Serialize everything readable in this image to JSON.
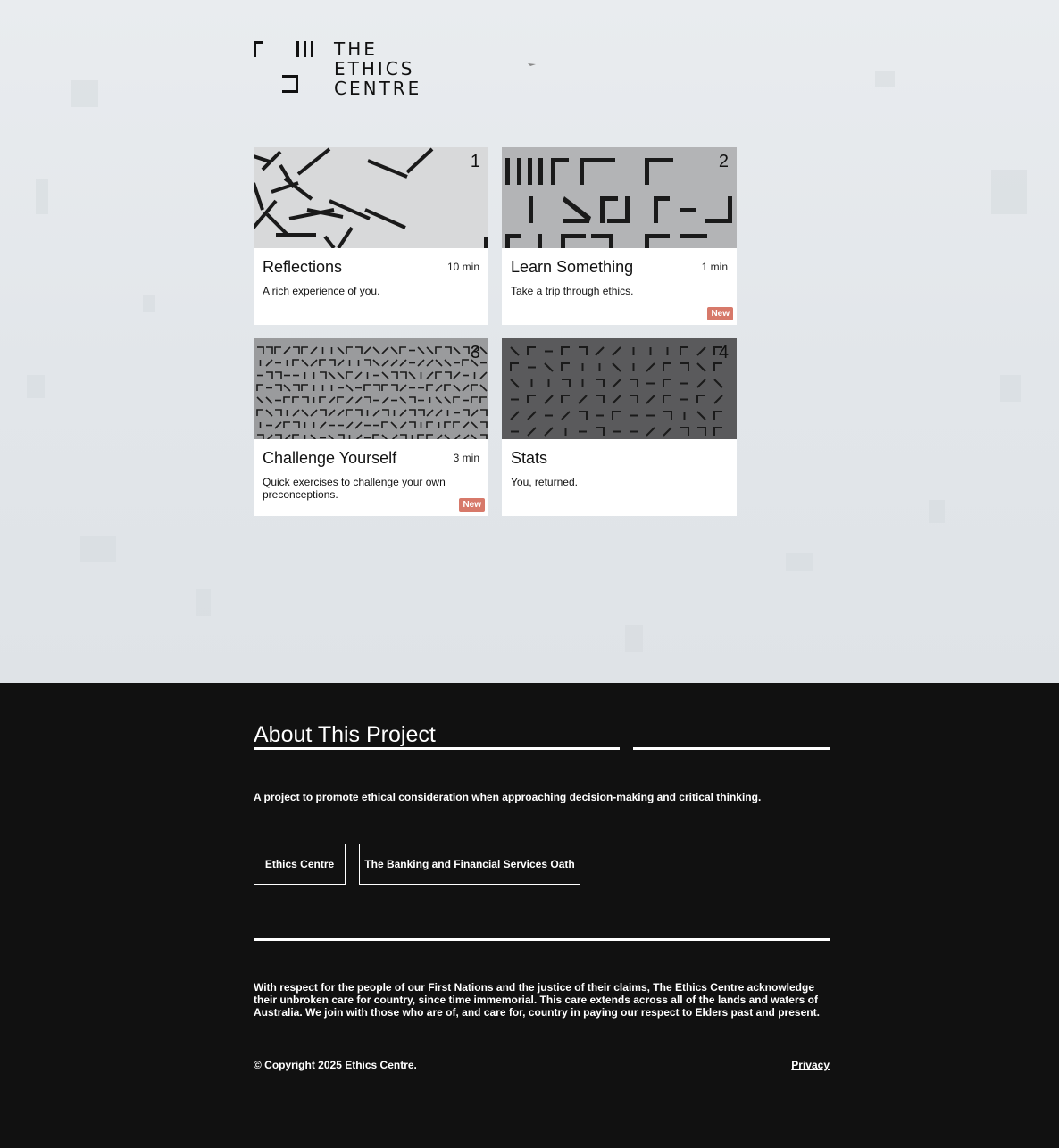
{
  "header": {
    "logo_lines": [
      "THE",
      "ETHICS",
      "CENTRE"
    ]
  },
  "cards": [
    {
      "number": "1",
      "title": "Reflections",
      "time": "10 min",
      "desc": "A rich experience of you.",
      "badge": ""
    },
    {
      "number": "2",
      "title": "Learn Something",
      "time": "1 min",
      "desc": "Take a trip through ethics.",
      "badge": "New"
    },
    {
      "number": "3",
      "title": "Challenge Yourself",
      "time": "3 min",
      "desc": "Quick exercises to challenge your own preconceptions.",
      "badge": "New"
    },
    {
      "number": "4",
      "title": "Stats",
      "time": "",
      "desc": "You, returned.",
      "badge": ""
    }
  ],
  "footer": {
    "about_title": "About This Project",
    "about_desc": "A project to promote ethical consideration when approaching decision-making and critical thinking.",
    "links": [
      "Ethics Centre",
      "The Banking and Financial Services Oath"
    ],
    "acknowledgement": "With respect for the people of our First Nations and the justice of their claims, The Ethics Centre acknowledge their unbroken care for country, since time immemorial. This care extends across all of the lands and waters of Australia. We join with those who are of, and care for, country in paying our respect to Elders past and present.",
    "copyright": "© Copyright 2025 Ethics Centre.",
    "privacy": "Privacy"
  },
  "colors": {
    "badge": "#d7796a",
    "footer_bg": "#111111",
    "card_bg_1": "#d8d9da",
    "card_bg_2": "#b3b4b6",
    "card_bg_3": "#9a9b9d",
    "card_bg_4": "#5a5a5c"
  }
}
